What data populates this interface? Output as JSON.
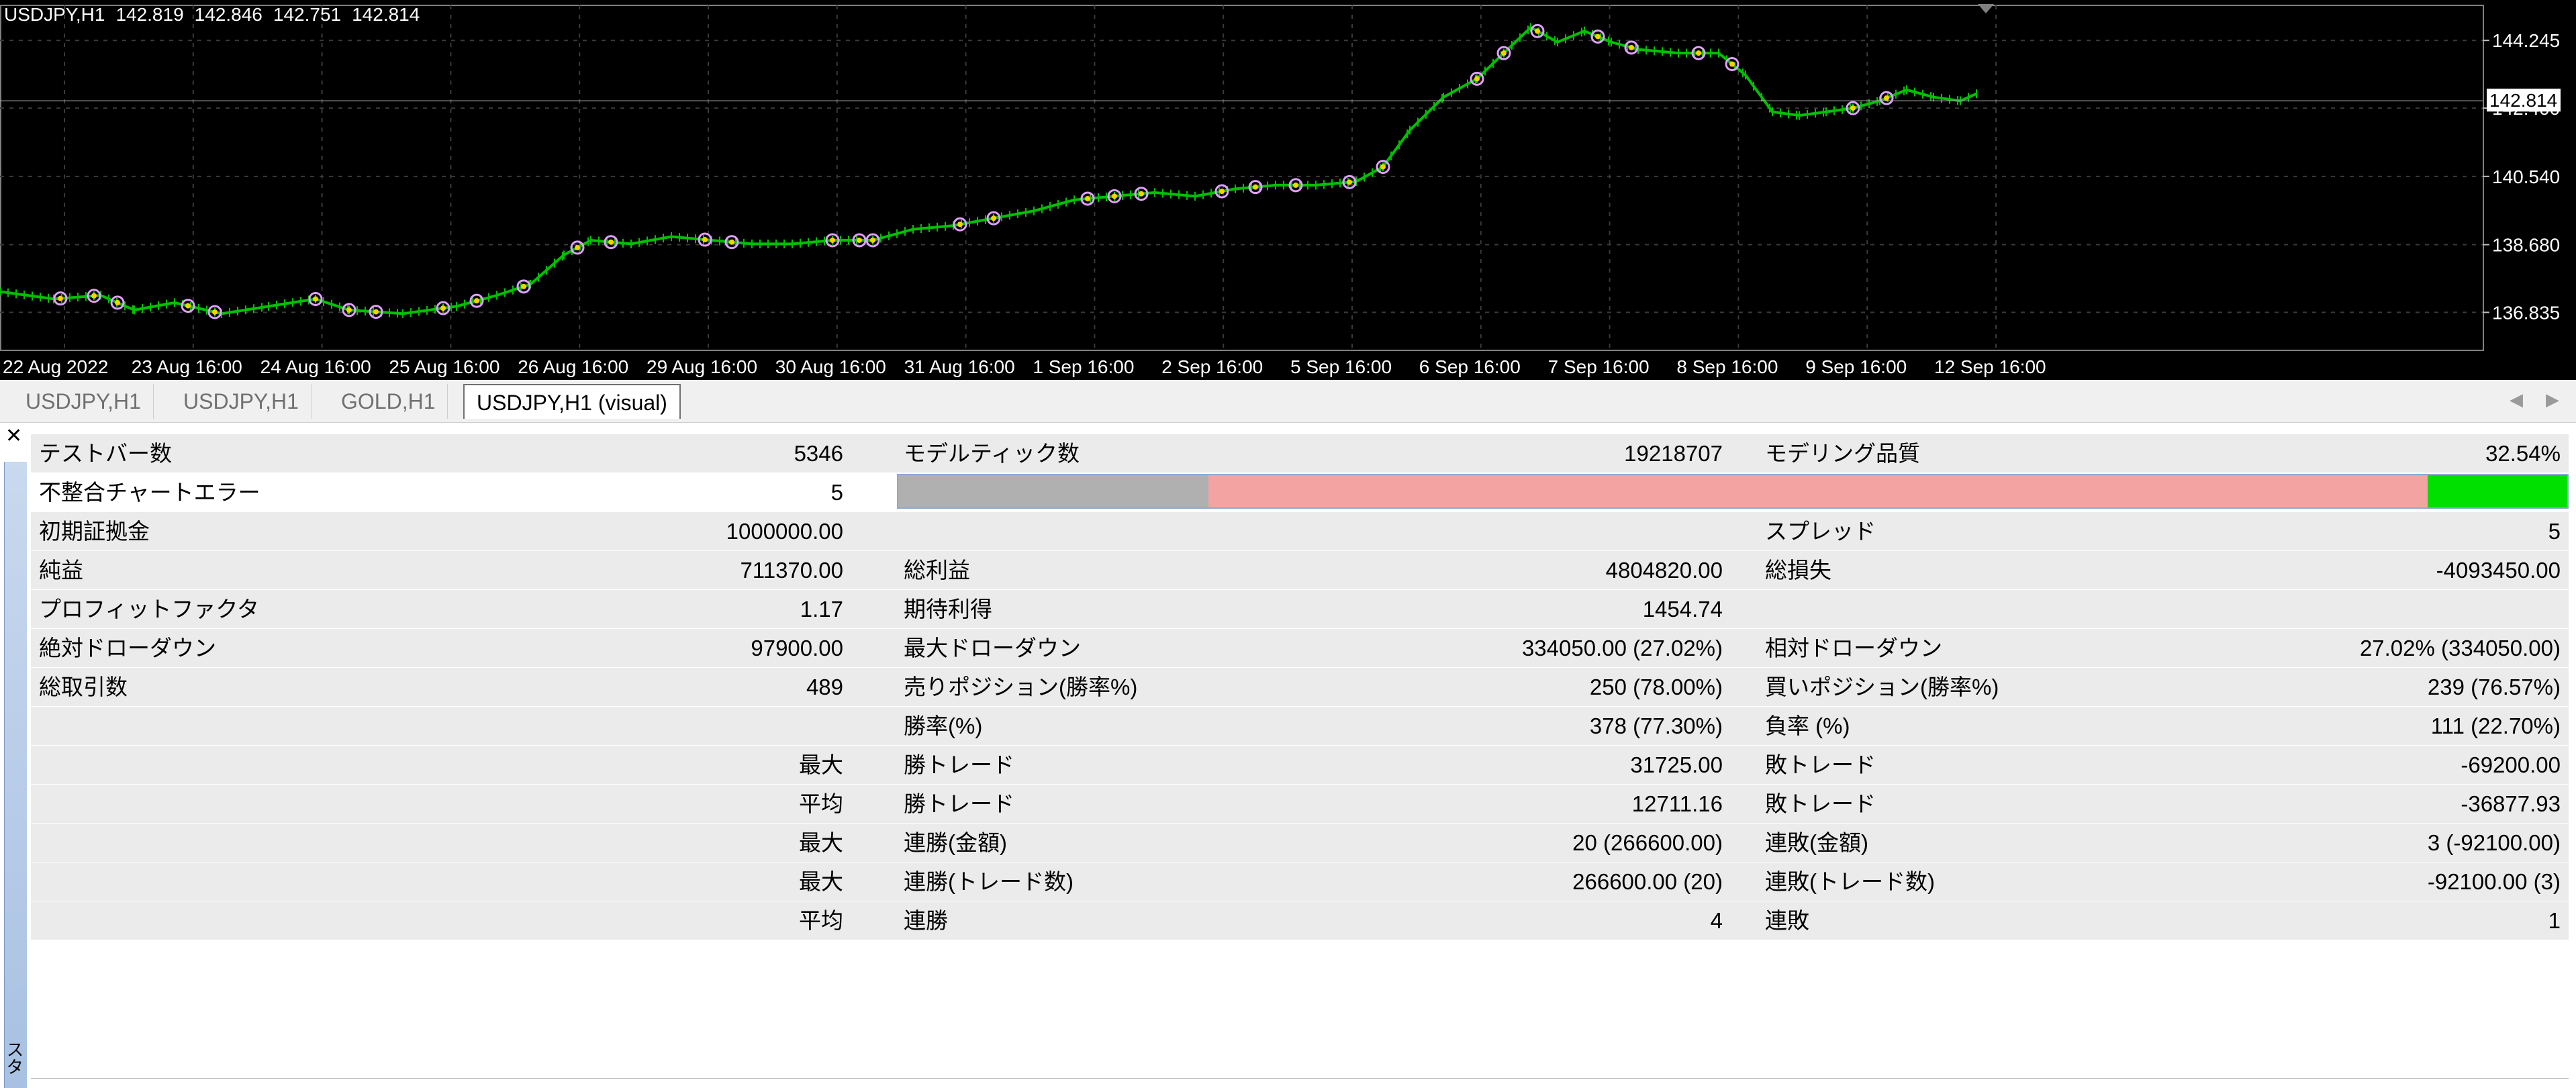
{
  "chart": {
    "symbol": "USDJPY,H1",
    "ohlc": [
      "142.819",
      "142.846",
      "142.751",
      "142.814"
    ],
    "current_price": "142.814",
    "y_ticks": [
      "144.245",
      "142.400",
      "140.540",
      "138.680",
      "136.835"
    ],
    "x_ticks": [
      "22 Aug 2022",
      "23 Aug 16:00",
      "24 Aug 16:00",
      "25 Aug 16:00",
      "26 Aug 16:00",
      "29 Aug 16:00",
      "30 Aug 16:00",
      "31 Aug 16:00",
      "1 Sep 16:00",
      "2 Sep 16:00",
      "5 Sep 16:00",
      "6 Sep 16:00",
      "7 Sep 16:00",
      "8 Sep 16:00",
      "9 Sep 16:00",
      "12 Sep 16:00"
    ],
    "colors": {
      "background": "#000000",
      "candles": "#00c000",
      "grid": "#3a3a3a",
      "text": "#ffffff"
    }
  },
  "tabs": [
    {
      "label": "USDJPY,H1",
      "active": false
    },
    {
      "label": "USDJPY,H1",
      "active": false
    },
    {
      "label": "GOLD,H1",
      "active": false
    },
    {
      "label": "USDJPY,H1 (visual)",
      "active": true
    }
  ],
  "side_label": "スター",
  "report": {
    "rows": [
      {
        "c1l": "テストバー数",
        "c1v": "5346",
        "c2l": "モデルティック数",
        "c2v": "19218707",
        "c3l": "モデリング品質",
        "c3v": "32.54%"
      },
      {
        "c1l": "不整合チャートエラー",
        "c1v": "5",
        "c2l": "",
        "c2v": "",
        "c3l": "",
        "c3v": ""
      },
      {
        "c1l": "初期証拠金",
        "c1v": "1000000.00",
        "c2l": "",
        "c2v": "",
        "c3l": "スプレッド",
        "c3v": "5"
      },
      {
        "c1l": "純益",
        "c1v": "711370.00",
        "c2l": "総利益",
        "c2v": "4804820.00",
        "c3l": "総損失",
        "c3v": "-4093450.00"
      },
      {
        "c1l": "プロフィットファクタ",
        "c1v": "1.17",
        "c2l": "期待利得",
        "c2v": "1454.74",
        "c3l": "",
        "c3v": ""
      },
      {
        "c1l": "絶対ドローダウン",
        "c1v": "97900.00",
        "c2l": "最大ドローダウン",
        "c2v": "334050.00 (27.02%)",
        "c3l": "相対ドローダウン",
        "c3v": "27.02% (334050.00)"
      },
      {
        "c1l": "総取引数",
        "c1v": "489",
        "c2l": "売りポジション(勝率%)",
        "c2v": "250 (78.00%)",
        "c3l": "買いポジション(勝率%)",
        "c3v": "239 (76.57%)"
      },
      {
        "c1l": "",
        "c1v": "",
        "c2l": "勝率(%)",
        "c2v": "378 (77.30%)",
        "c3l": "負率 (%)",
        "c3v": "111 (22.70%)"
      },
      {
        "c1l": "",
        "c1v": "最大",
        "c2l": "勝トレード",
        "c2v": "31725.00",
        "c3l": "敗トレード",
        "c3v": "-69200.00"
      },
      {
        "c1l": "",
        "c1v": "平均",
        "c2l": "勝トレード",
        "c2v": "12711.16",
        "c3l": "敗トレード",
        "c3v": "-36877.93"
      },
      {
        "c1l": "",
        "c1v": "最大",
        "c2l": "連勝(金額)",
        "c2v": "20 (266600.00)",
        "c3l": "連敗(金額)",
        "c3v": "3 (-92100.00)"
      },
      {
        "c1l": "",
        "c1v": "最大",
        "c2l": "連勝(トレード数)",
        "c2v": "266600.00 (20)",
        "c3l": "連敗(トレード数)",
        "c3v": "-92100.00 (3)"
      },
      {
        "c1l": "",
        "c1v": "平均",
        "c2l": "連勝",
        "c2v": "4",
        "c3l": "連敗",
        "c3v": "1"
      }
    ],
    "quality_bar": [
      {
        "color": "#b0b0b0",
        "fraction": 0.186
      },
      {
        "color": "#f4a3a3",
        "fraction": 0.7305
      },
      {
        "color": "#00e000",
        "fraction": 0.0835
      }
    ]
  }
}
